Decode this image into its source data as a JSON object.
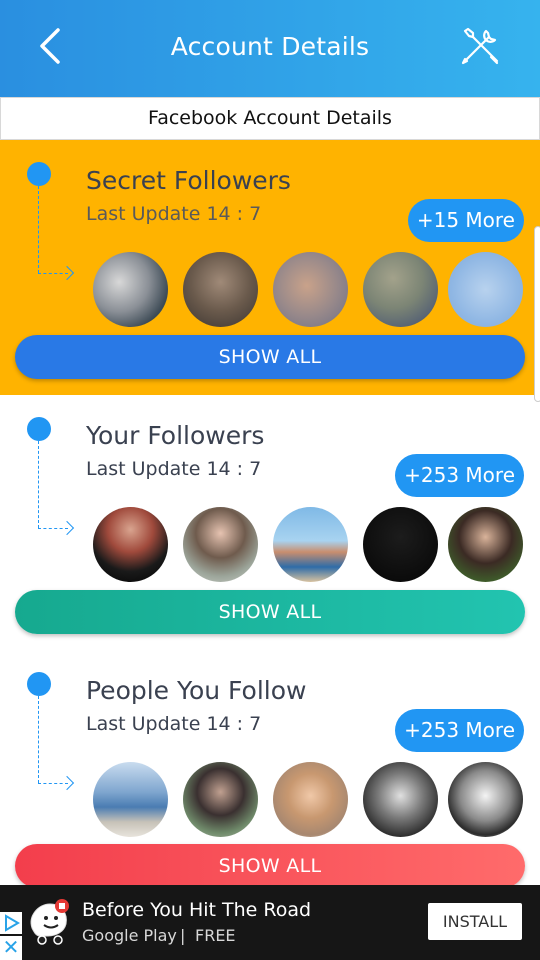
{
  "header": {
    "title": "Account Details",
    "back_icon": "chevron-left-icon",
    "tools_icon": "tools-icon"
  },
  "subheader": {
    "title": "Facebook Account Details"
  },
  "sections": [
    {
      "title": "Secret Followers",
      "update": "Last Update 14 : 7",
      "more": "+15 More",
      "button": "SHOW ALL",
      "bg_color": "#ffb300",
      "button_color": "#2979e6"
    },
    {
      "title": "Your Followers",
      "update": "Last Update 14 : 7",
      "more": "+253 More",
      "button": "SHOW ALL",
      "bg_color": "#ffffff",
      "button_color": "#1bb79f"
    },
    {
      "title": "People You Follow",
      "update": "Last Update 14 : 7",
      "more": "+253 More",
      "button": "SHOW ALL",
      "bg_color": "#ffffff",
      "button_color": "#f9515a"
    }
  ],
  "ad": {
    "title": "Before You Hit The Road",
    "store": "Google Play",
    "separator": "|",
    "price": "FREE",
    "install_label": "INSTALL",
    "close_label": "✕"
  }
}
